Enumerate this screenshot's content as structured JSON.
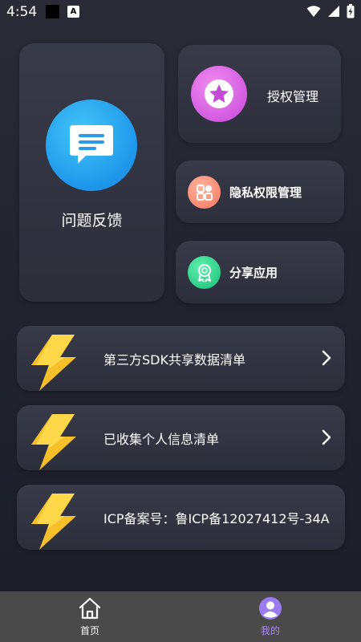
{
  "status_bar": {
    "time": "4:54",
    "notif_letter": "A"
  },
  "feedback": {
    "label": "问题反馈",
    "icon": "chat-bubble-icon",
    "color": "#1e96ea"
  },
  "authorization": {
    "label": "授权管理",
    "icon": "star-badge-icon",
    "color": "#d35be0"
  },
  "privacy": {
    "label": "隐私权限管理",
    "icon": "apps-grid-icon",
    "color": "#f6826a"
  },
  "share": {
    "label": "分享应用",
    "icon": "award-ribbon-icon",
    "color": "#26c883"
  },
  "list": [
    {
      "label": "第三方SDK共享数据清单",
      "has_chevron": true
    },
    {
      "label": "已收集个人信息清单",
      "has_chevron": true
    },
    {
      "label": "ICP备案号：鲁ICP备12027412号-34A",
      "has_chevron": false
    }
  ],
  "bottom_nav": {
    "items": [
      {
        "label": "首页",
        "icon": "home-icon",
        "active": false
      },
      {
        "label": "我的",
        "icon": "user-avatar-icon",
        "active": true
      }
    ],
    "active_color": "#a98cf2"
  }
}
